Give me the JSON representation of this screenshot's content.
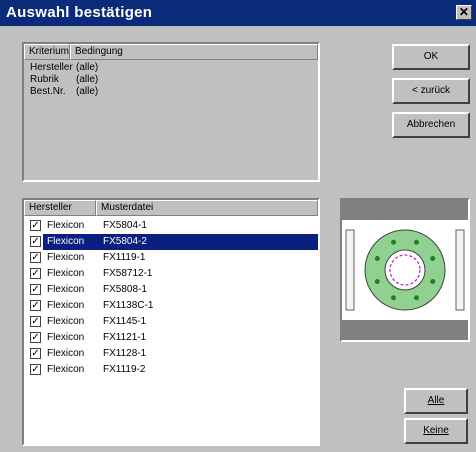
{
  "dialog": {
    "title": "Auswahl bestätigen",
    "close_label": "✕"
  },
  "criteria": {
    "columns": [
      "Kriterium",
      "Bedingung"
    ],
    "rows": [
      {
        "criterion": "Hersteller",
        "condition": "(alle)"
      },
      {
        "criterion": "Rubrik",
        "condition": "(alle)"
      },
      {
        "criterion": "Best.Nr.",
        "condition": "(alle)"
      }
    ]
  },
  "patterns": {
    "columns": [
      "Hersteller",
      "Musterdatei"
    ],
    "selected_index": 1,
    "rows": [
      {
        "checked": true,
        "manufacturer": "Flexicon",
        "file": "FX5804-1"
      },
      {
        "checked": true,
        "manufacturer": "Flexicon",
        "file": "FX5804-2"
      },
      {
        "checked": true,
        "manufacturer": "Flexicon",
        "file": "FX1119-1"
      },
      {
        "checked": true,
        "manufacturer": "Flexicon",
        "file": "FX58712-1"
      },
      {
        "checked": true,
        "manufacturer": "Flexicon",
        "file": "FX5808-1"
      },
      {
        "checked": true,
        "manufacturer": "Flexicon",
        "file": "FX1138C-1"
      },
      {
        "checked": true,
        "manufacturer": "Flexicon",
        "file": "FX1145-1"
      },
      {
        "checked": true,
        "manufacturer": "Flexicon",
        "file": "FX1121-1"
      },
      {
        "checked": true,
        "manufacturer": "Flexicon",
        "file": "FX1128-1"
      },
      {
        "checked": true,
        "manufacturer": "Flexicon",
        "file": "FX1119-2"
      }
    ]
  },
  "buttons": {
    "ok": "OK",
    "back": "< zurück",
    "cancel": "Abbrechen",
    "all": "Alle",
    "none": "Keine"
  },
  "preview": {
    "colors": {
      "frame": "#808080",
      "flange": "#90d090",
      "hub": "#ffffff",
      "bolt": "#208020",
      "seal": "#b020c0"
    }
  }
}
